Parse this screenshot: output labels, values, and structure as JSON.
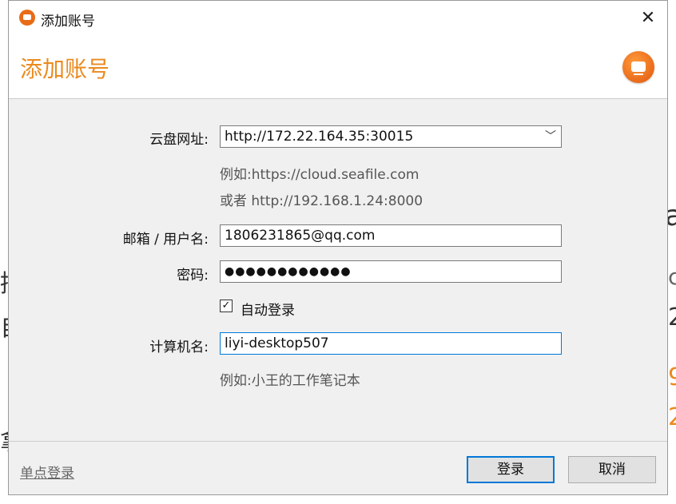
{
  "window": {
    "title": "添加账号"
  },
  "header": {
    "title": "添加账号"
  },
  "form": {
    "server_label": "云盘网址:",
    "server_value": "http://172.22.164.35:30015",
    "server_hint_1": "例如:https://cloud.seafile.com",
    "server_hint_2": "或者 http://192.168.1.24:8000",
    "email_label": "邮箱 / 用户名:",
    "email_value": "1806231865@qq.com",
    "password_label": "密码:",
    "password_value": "●●●●●●●●●●●●",
    "auto_login_label": "自动登录",
    "auto_login_checked": true,
    "computer_label": "计算机名:",
    "computer_value": "liyi-desktop507",
    "computer_hint": "例如:小王的工作笔记本"
  },
  "footer": {
    "sso_label": "单点登录",
    "login_label": "登录",
    "cancel_label": "取消"
  },
  "colors": {
    "accent": "#eb8a1f",
    "focus": "#0078d7",
    "logo": "#e86b18"
  }
}
